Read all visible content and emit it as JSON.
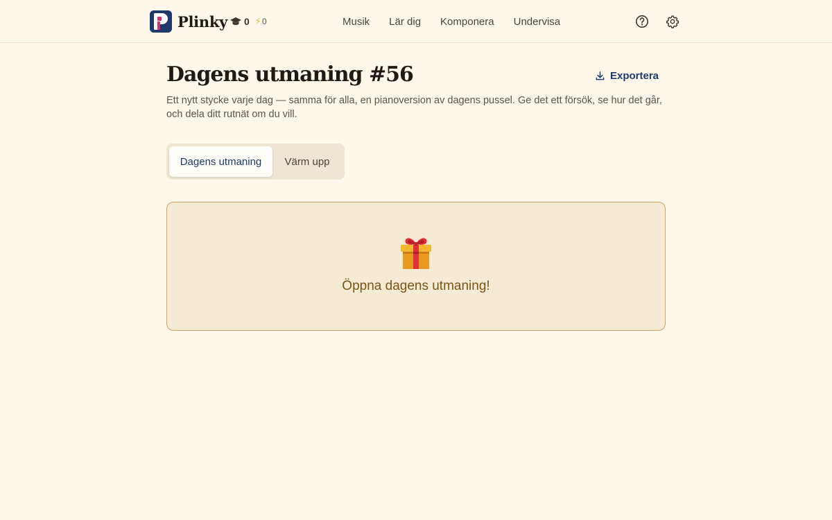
{
  "header": {
    "brand_name": "Plinky",
    "logo_letter": "P",
    "stats": {
      "graduation_count": "0",
      "streak_count": "0",
      "graduation_icon": "graduation-cap-icon",
      "streak_icon": "lightning-bolt-icon"
    },
    "nav": [
      "Musik",
      "Lär dig",
      "Komponera",
      "Undervisa"
    ],
    "help_icon": "help-circle-icon",
    "settings_icon": "gear-icon"
  },
  "main": {
    "title": "Dagens utmaning #56",
    "export_label": "Exportera",
    "export_icon": "download-icon",
    "subtitle": "Ett nytt stycke varje dag — samma för alla, en pianoversion av dagens pussel. Ge det ett försök, se hur det går, och dela ditt rutnät om du vill.",
    "tabs": [
      {
        "label": "Dagens utmaning",
        "active": true
      },
      {
        "label": "Värm upp",
        "active": false
      }
    ],
    "gift_card": {
      "icon": "gift-icon",
      "label": "Öppna dagens utmaning!"
    }
  },
  "colors": {
    "background": "#fdf7ec",
    "brand": "#1f3a6a",
    "accent": "#c9a660",
    "card_bg": "#f5ead3",
    "card_text": "#7a5316"
  }
}
